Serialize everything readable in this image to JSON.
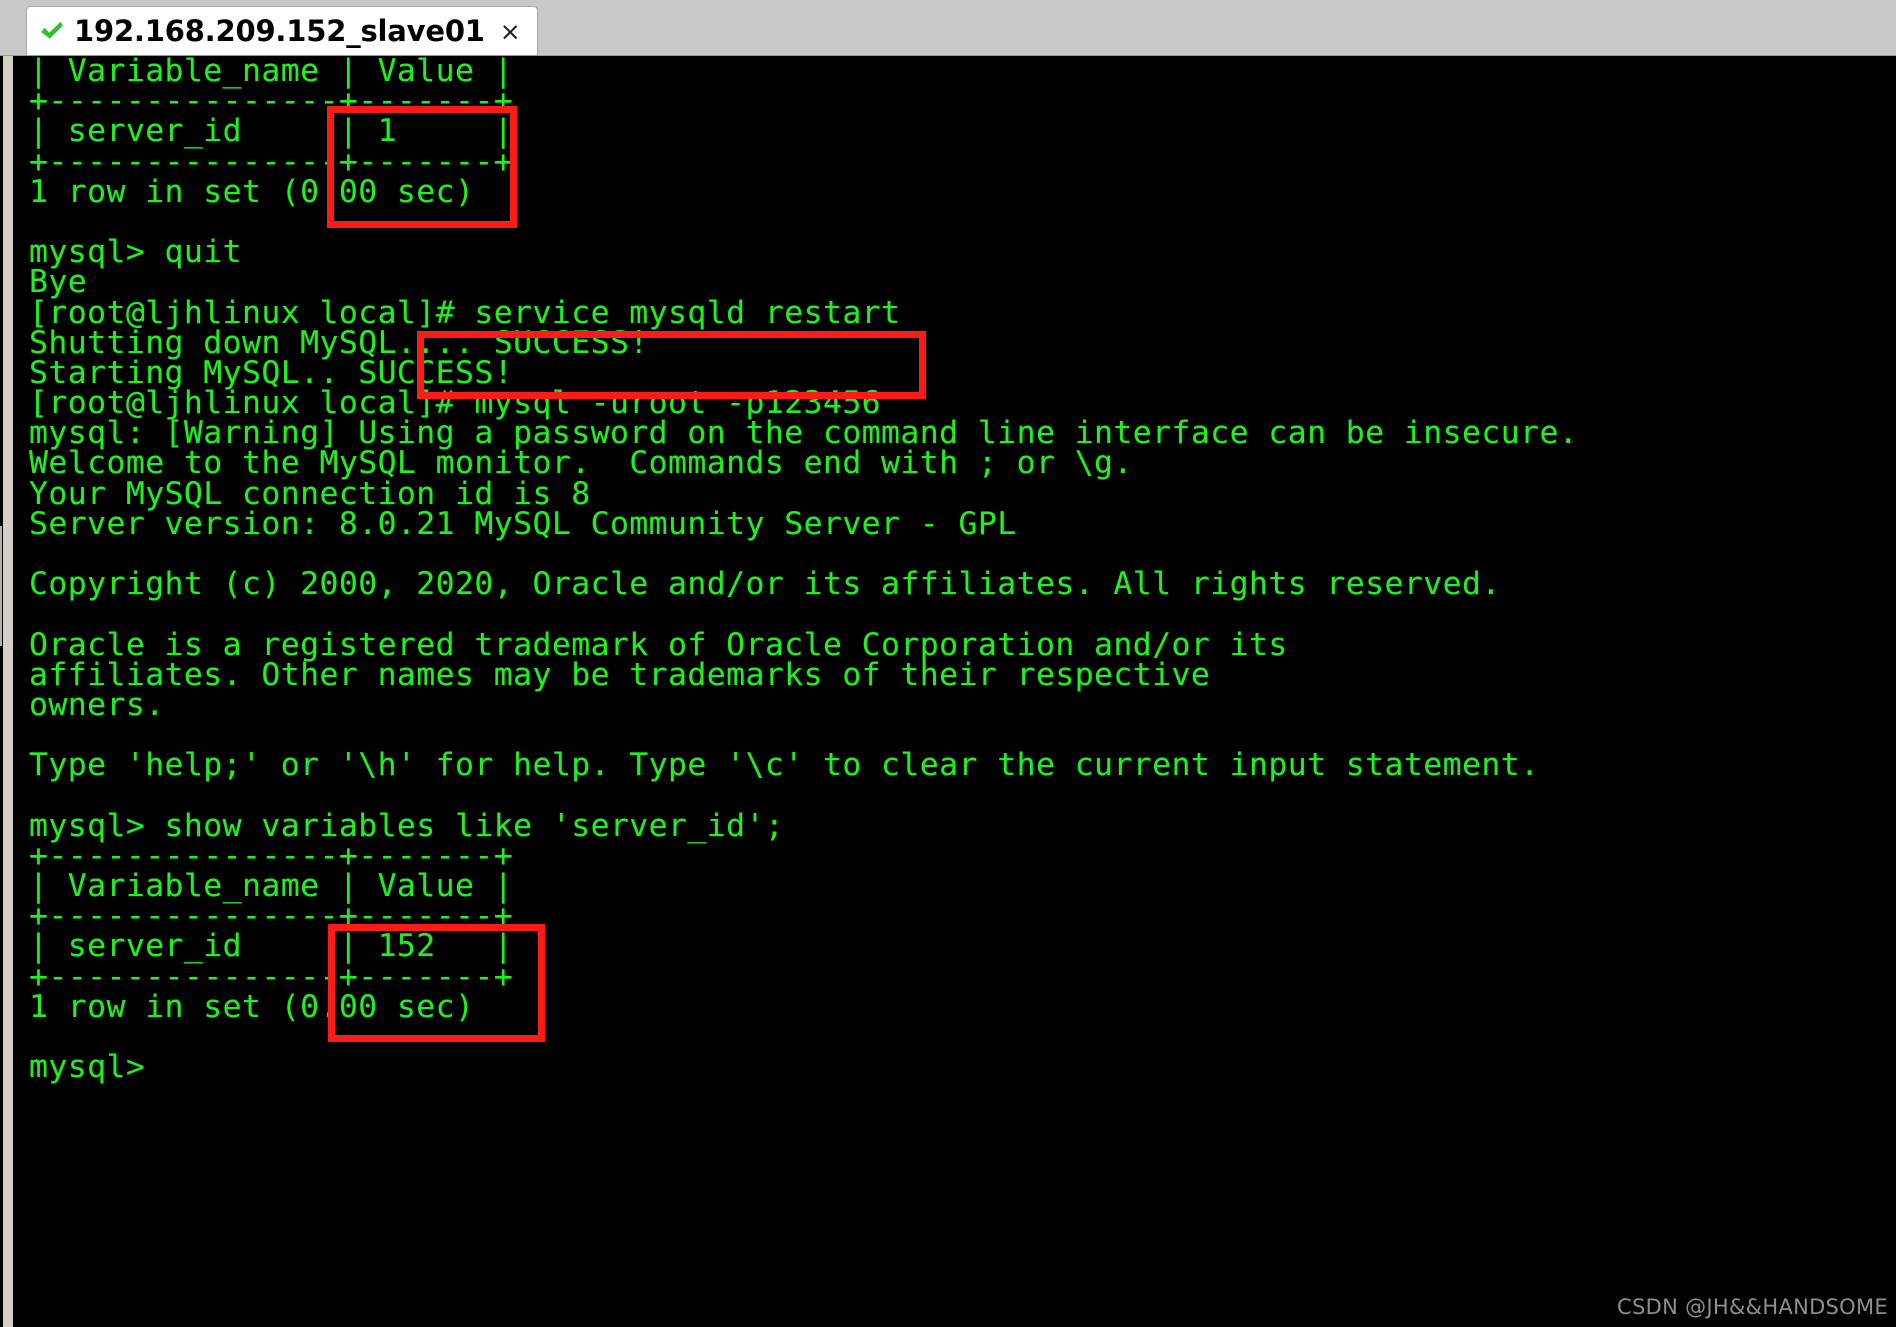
{
  "window": {
    "tab": {
      "status_icon": "green-check-icon",
      "title": "192.168.209.152_slave01",
      "close_label": "×"
    },
    "chrome_color": "#c8c8c8"
  },
  "terminal": {
    "background": "#000000",
    "foreground": "#22ee22",
    "prompt_shell": "[root@ljhlinux local]#",
    "prompt_mysql": "mysql>",
    "lines": [
      "| Variable_name | Value |",
      "+---------------+-------+",
      "| server_id     | 1     |",
      "+---------------+-------+",
      "1 row in set (0.00 sec)",
      "",
      "mysql> quit",
      "Bye",
      "[root@ljhlinux local]# service mysqld restart",
      "Shutting down MySQL.... SUCCESS!",
      "Starting MySQL.. SUCCESS!",
      "[root@ljhlinux local]# mysql -uroot -p123456",
      "mysql: [Warning] Using a password on the command line interface can be insecure.",
      "Welcome to the MySQL monitor.  Commands end with ; or \\g.",
      "Your MySQL connection id is 8",
      "Server version: 8.0.21 MySQL Community Server - GPL",
      "",
      "Copyright (c) 2000, 2020, Oracle and/or its affiliates. All rights reserved.",
      "",
      "Oracle is a registered trademark of Oracle Corporation and/or its",
      "affiliates. Other names may be trademarks of their respective",
      "owners.",
      "",
      "Type 'help;' or '\\h' for help. Type '\\c' to clear the current input statement.",
      "",
      "mysql> show variables like 'server_id';",
      "+---------------+-------+",
      "| Variable_name | Value |",
      "+---------------+-------+",
      "| server_id     | 152   |",
      "+---------------+-------+",
      "1 row in set (0.00 sec)",
      "",
      "mysql>"
    ]
  },
  "tables": [
    {
      "columns": [
        "Variable_name",
        "Value"
      ],
      "rows": [
        [
          "server_id",
          "1"
        ]
      ],
      "footer": "1 row in set (0.00 sec)"
    },
    {
      "query": "show variables like 'server_id';",
      "columns": [
        "Variable_name",
        "Value"
      ],
      "rows": [
        [
          "server_id",
          "152"
        ]
      ],
      "footer": "1 row in set (0.00 sec)"
    }
  ],
  "commands": [
    "quit",
    "service mysqld restart",
    "mysql -uroot -p123456",
    "show variables like 'server_id';"
  ],
  "annotations": {
    "color": "#fb1b17",
    "boxes": [
      {
        "id": "annot-1",
        "highlights": "Value column of first server_id result (value 1)"
      },
      {
        "id": "annot-2",
        "highlights": "service mysqld restart command"
      },
      {
        "id": "annot-3",
        "highlights": "Value column of second server_id result (value 152)"
      }
    ]
  },
  "watermark": "CSDN @JH&&HANDSOME"
}
